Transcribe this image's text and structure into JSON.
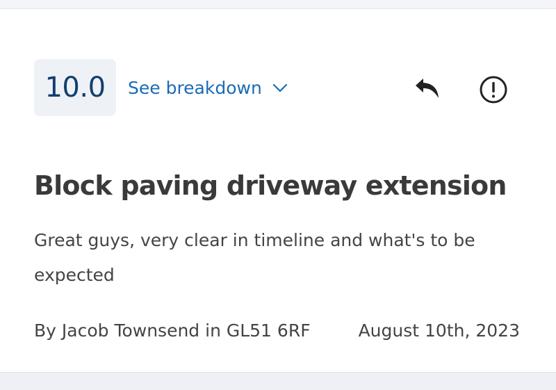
{
  "review": {
    "score": "10.0",
    "breakdown_label": "See breakdown",
    "title": "Block paving driveway extension",
    "text": "Great guys, very clear in timeline and what's to be expected",
    "author_line": "By Jacob Townsend in GL51 6RF",
    "date": "August 10th, 2023"
  },
  "icons": {
    "breakdown": "chevron-down-icon",
    "reply": "reply-icon",
    "report": "alert-circle-icon"
  },
  "colors": {
    "score_text": "#123f6e",
    "score_bg": "#eef1f6",
    "link": "#1a6bb5",
    "title": "#3a3a3a",
    "body": "#444444"
  }
}
